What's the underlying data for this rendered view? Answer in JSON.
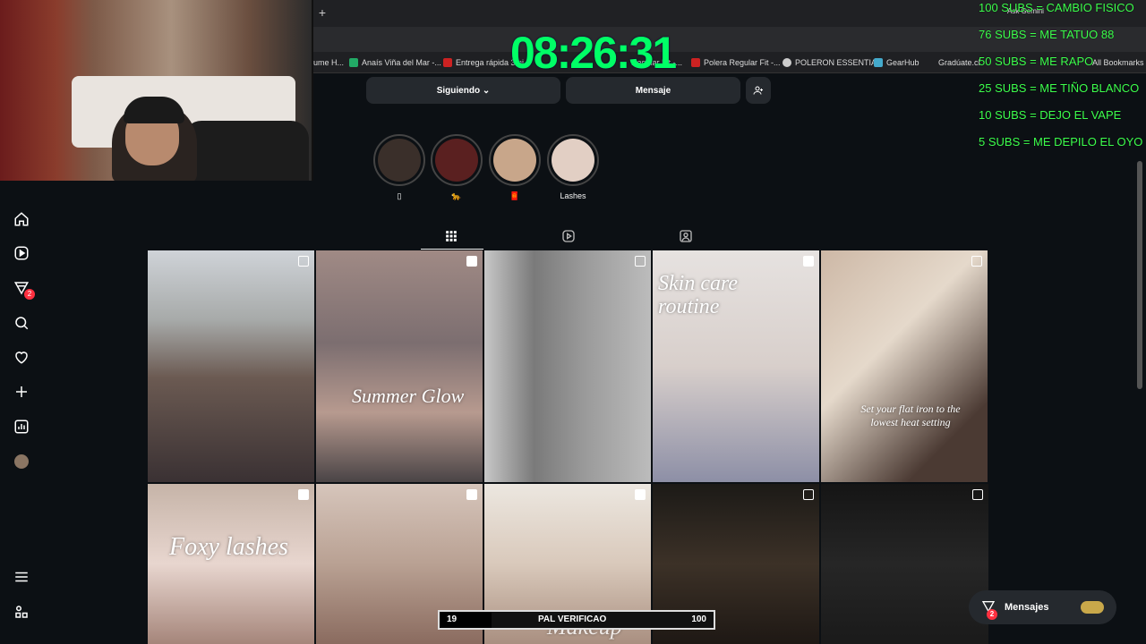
{
  "browser": {
    "new_tab": "+",
    "bookmarks": [
      "ume H...",
      "Anaís Viña del Mar -...",
      "Entrega rápida 3mi",
      "Regular Fit -...",
      "Polera Regular Fit -...",
      "POLERON ESSENTIA...",
      "GearHub",
      "Gradúate.cl",
      "All Bookmarks"
    ],
    "ask_gemini": "Ask Gemini"
  },
  "clock": "08:26:31",
  "subs_goals": [
    "100 SUBS = CAMBIO FISICO",
    "76 SUBS = ME TATUO 88",
    "50 SUBS = ME RAPO",
    "25 SUBS = ME TIÑO BLANCO",
    "10 SUBS = DEJO EL VAPE",
    "5 SUBS = ME DEPILO EL OYO"
  ],
  "nav": {
    "notifications_badge": "2"
  },
  "profile": {
    "following_label": "Siguiendo",
    "message_label": "Mensaje",
    "stories": [
      {
        "label": "▯",
        "color": "#3a2f2a"
      },
      {
        "label": "🐆",
        "color": "#5a2020"
      },
      {
        "label": "🧧",
        "color": "#c8a68a"
      },
      {
        "label": "Lashes",
        "color": "#e2cfc4"
      }
    ]
  },
  "posts": [
    {
      "bg": "linear-gradient(180deg,#cfd3d8 0%,#a7aaa9 30%,#6b5a52 55%,#3a3133 100%)",
      "type": "multi"
    },
    {
      "bg": "linear-gradient(180deg,#a08a85 0%,#7c6e70 40%,#b79a8f 70%,#4a4446 100%)",
      "type": "video",
      "overlay": "Summer Glow"
    },
    {
      "bg": "linear-gradient(90deg,#c7c7c7 0%,#7a7a7a 30%,#9a9a9a 60%,#bcbcbc 100%)",
      "type": "multi"
    },
    {
      "bg": "linear-gradient(180deg,#e6e2e0 0%,#d8cfcb 50%,#8d8fa6 100%)",
      "type": "video",
      "overlay": "Skin care routine"
    },
    {
      "bg": "linear-gradient(135deg,#cdb8a6 0%,#e5d9cb 40%,#4b3a33 80%)",
      "type": "multi",
      "overlay": "Set your flat iron to the lowest heat setting"
    },
    {
      "bg": "linear-gradient(180deg,#c6b4a8 0%,#e8d6cf 50%,#a5857a 100%)",
      "type": "video",
      "overlay": "Foxy lashes"
    },
    {
      "bg": "linear-gradient(180deg,#d6c5bb 0%,#b9a193 50%,#8a6b5f 100%)",
      "type": "video"
    },
    {
      "bg": "linear-gradient(180deg,#ece7e0 0%,#d9c9bb 50%,#a98f80 100%)",
      "type": "video",
      "overlay": "Makeup"
    },
    {
      "bg": "linear-gradient(180deg,#1c1a17 0%,#3c3127 50%,#1e1814 100%)",
      "type": "multi"
    },
    {
      "bg": "linear-gradient(180deg,#151515 0%,#262626 50%,#1a1a1a 100%)",
      "type": "multi"
    }
  ],
  "progress": {
    "current": "19",
    "label": "PAL VERIFICAO",
    "goal": "100",
    "fraction": 0.19
  },
  "messages": {
    "label": "Mensajes",
    "badge": "2"
  }
}
